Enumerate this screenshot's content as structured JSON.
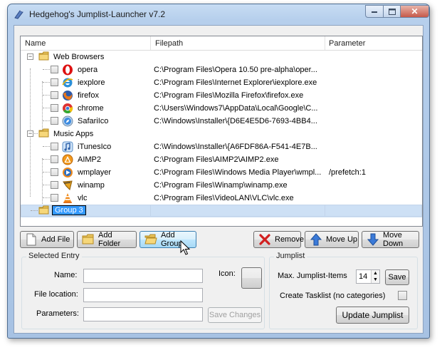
{
  "window": {
    "title": "Hedgehog's Jumplist-Launcher v7.2"
  },
  "columns": {
    "name": "Name",
    "filepath": "Filepath",
    "parameter": "Parameter"
  },
  "tree": [
    {
      "type": "group",
      "label": "Web Browsers"
    },
    {
      "type": "item",
      "label": "opera",
      "path": "C:\\Program Files\\Opera 10.50 pre-alpha\\oper...",
      "param": "",
      "icon": "opera-icon"
    },
    {
      "type": "item",
      "label": "iexplore",
      "path": "C:\\Program Files\\Internet Explorer\\iexplore.exe",
      "param": "",
      "icon": "internet-explorer-icon"
    },
    {
      "type": "item",
      "label": "firefox",
      "path": "C:\\Program Files\\Mozilla Firefox\\firefox.exe",
      "param": "",
      "icon": "firefox-icon"
    },
    {
      "type": "item",
      "label": "chrome",
      "path": "C:\\Users\\Windows7\\AppData\\Local\\Google\\C...",
      "param": "",
      "icon": "chrome-icon"
    },
    {
      "type": "item",
      "label": "SafariIco",
      "path": "C:\\Windows\\Installer\\{D6E4E5D6-7693-4BB4...",
      "param": "",
      "icon": "safari-icon"
    },
    {
      "type": "group",
      "label": "Music Apps"
    },
    {
      "type": "item",
      "label": "iTunesIco",
      "path": "C:\\Windows\\Installer\\{A6FDF86A-F541-4E7B...",
      "param": "",
      "icon": "itunes-icon"
    },
    {
      "type": "item",
      "label": "AIMP2",
      "path": "C:\\Program Files\\AIMP2\\AIMP2.exe",
      "param": "",
      "icon": "aimp-icon"
    },
    {
      "type": "item",
      "label": "wmplayer",
      "path": "C:\\Program Files\\Windows Media Player\\wmpl...",
      "param": "/prefetch:1",
      "icon": "wmplayer-icon"
    },
    {
      "type": "item",
      "label": "winamp",
      "path": "C:\\Program Files\\Winamp\\winamp.exe",
      "param": "",
      "icon": "winamp-icon"
    },
    {
      "type": "item",
      "label": "vlc",
      "path": "C:\\Program Files\\VideoLAN\\VLC\\vlc.exe",
      "param": "",
      "icon": "vlc-icon"
    },
    {
      "type": "group",
      "label": "Group 3",
      "selected": true
    }
  ],
  "toolbar": {
    "add_file": "Add File",
    "add_folder": "Add Folder",
    "add_group": "Add Group",
    "remove": "Remove",
    "move_up": "Move Up",
    "move_down": "Move Down"
  },
  "selected_entry": {
    "title": "Selected Entry",
    "name_label": "Name:",
    "name_value": "",
    "location_label": "File location:",
    "location_value": "",
    "parameters_label": "Parameters:",
    "parameters_value": "",
    "icon_label": "Icon:",
    "save_changes": "Save Changes"
  },
  "jumplist": {
    "title": "Jumplist",
    "max_label": "Max. Jumplist-Items",
    "max_value": "14",
    "save": "Save",
    "tasklist_label": "Create Tasklist (no categories)",
    "update": "Update Jumplist"
  }
}
